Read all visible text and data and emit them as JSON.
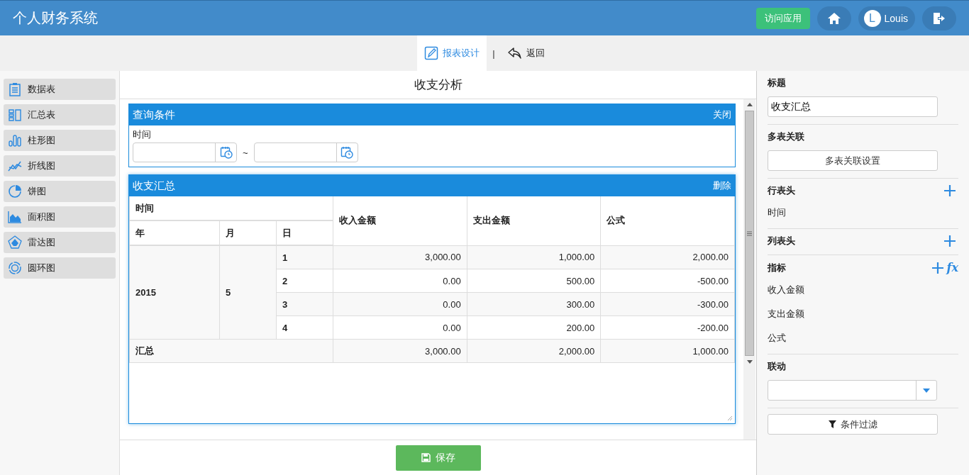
{
  "header": {
    "title": "个人财务系统",
    "visit_button": "访问应用",
    "user": {
      "initial": "L",
      "name": "Louis"
    }
  },
  "toolbar": {
    "tabs": [
      {
        "label": "报表设计",
        "kind": "design",
        "selected": true
      },
      {
        "label": "返回",
        "kind": "back",
        "selected": false
      }
    ],
    "separator": "|"
  },
  "sidebar": {
    "items": [
      {
        "label": "数据表",
        "kind": "table"
      },
      {
        "label": "汇总表",
        "kind": "summary"
      },
      {
        "label": "柱形图",
        "kind": "bar"
      },
      {
        "label": "折线图",
        "kind": "line"
      },
      {
        "label": "饼图",
        "kind": "pie"
      },
      {
        "label": "面积图",
        "kind": "area"
      },
      {
        "label": "雷达图",
        "kind": "radar"
      },
      {
        "label": "圆环图",
        "kind": "donut"
      }
    ]
  },
  "page_title": "收支分析",
  "query_panel": {
    "title": "查询条件",
    "action": "关闭",
    "field_label": "时间",
    "range_separator": "~"
  },
  "summary_panel": {
    "title": "收支汇总",
    "action": "删除",
    "table": {
      "group_header": "时间",
      "level_headers": [
        "年",
        "月",
        "日"
      ],
      "value_headers": [
        "收入金额",
        "支出金额",
        "公式"
      ],
      "groups": [
        {
          "year": "2015",
          "month": "5",
          "rows": [
            {
              "day": "1",
              "values": [
                "3,000.00",
                "1,000.00",
                "2,000.00"
              ]
            },
            {
              "day": "2",
              "values": [
                "0.00",
                "500.00",
                "-500.00"
              ]
            },
            {
              "day": "3",
              "values": [
                "0.00",
                "300.00",
                "-300.00"
              ]
            },
            {
              "day": "4",
              "values": [
                "0.00",
                "200.00",
                "-200.00"
              ]
            }
          ]
        }
      ],
      "total": {
        "label": "汇总",
        "values": [
          "3,000.00",
          "2,000.00",
          "1,000.00"
        ]
      }
    }
  },
  "save_button": "保存",
  "properties": {
    "title": {
      "label": "标题",
      "value": "收支汇总"
    },
    "join": {
      "label": "多表关联",
      "button": "多表关联设置"
    },
    "row_headers": {
      "label": "行表头",
      "items": [
        "时间"
      ]
    },
    "column_headers": {
      "label": "列表头"
    },
    "indicators": {
      "label": "指标",
      "formula": "fx",
      "items": [
        "收入金额",
        "支出金额",
        "公式"
      ]
    },
    "linkage": {
      "label": "联动"
    },
    "filter_button": "条件过滤"
  }
}
